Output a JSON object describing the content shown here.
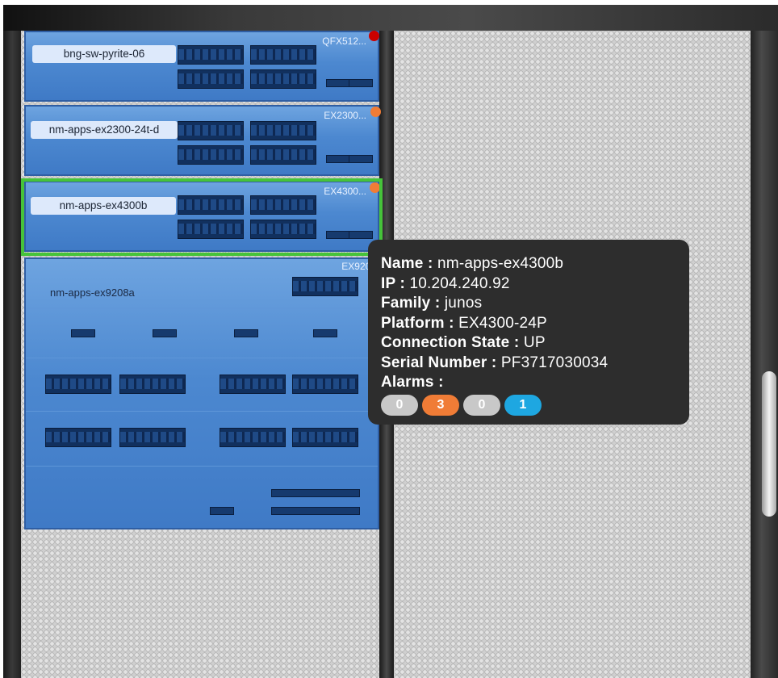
{
  "devices": [
    {
      "name": "bng-sw-pyrite-06",
      "model": "QFX512...",
      "status_color": "#cc0000"
    },
    {
      "name": "nm-apps-ex2300-24t-d",
      "model": "EX2300...",
      "status_color": "#f07c36"
    },
    {
      "name": "nm-apps-ex4300b",
      "model": "EX4300...",
      "status_color": "#f07c36"
    },
    {
      "name": "nm-apps-ex9208a",
      "model": "EX9208"
    }
  ],
  "tooltip": {
    "name_label": "Name :",
    "name_value": "nm-apps-ex4300b",
    "ip_label": "IP :",
    "ip_value": "10.204.240.92",
    "family_label": "Family :",
    "family_value": "junos",
    "platform_label": "Platform :",
    "platform_value": "EX4300-24P",
    "state_label": "Connection State :",
    "state_value": "UP",
    "serial_label": "Serial Number :",
    "serial_value": "PF3717030034",
    "alarms_label": "Alarms :",
    "alarms": [
      {
        "count": "0",
        "color": "#c8c8c8"
      },
      {
        "count": "3",
        "color": "#f07c36"
      },
      {
        "count": "0",
        "color": "#c8c8c8"
      },
      {
        "count": "1",
        "color": "#1ea7e1"
      }
    ]
  }
}
